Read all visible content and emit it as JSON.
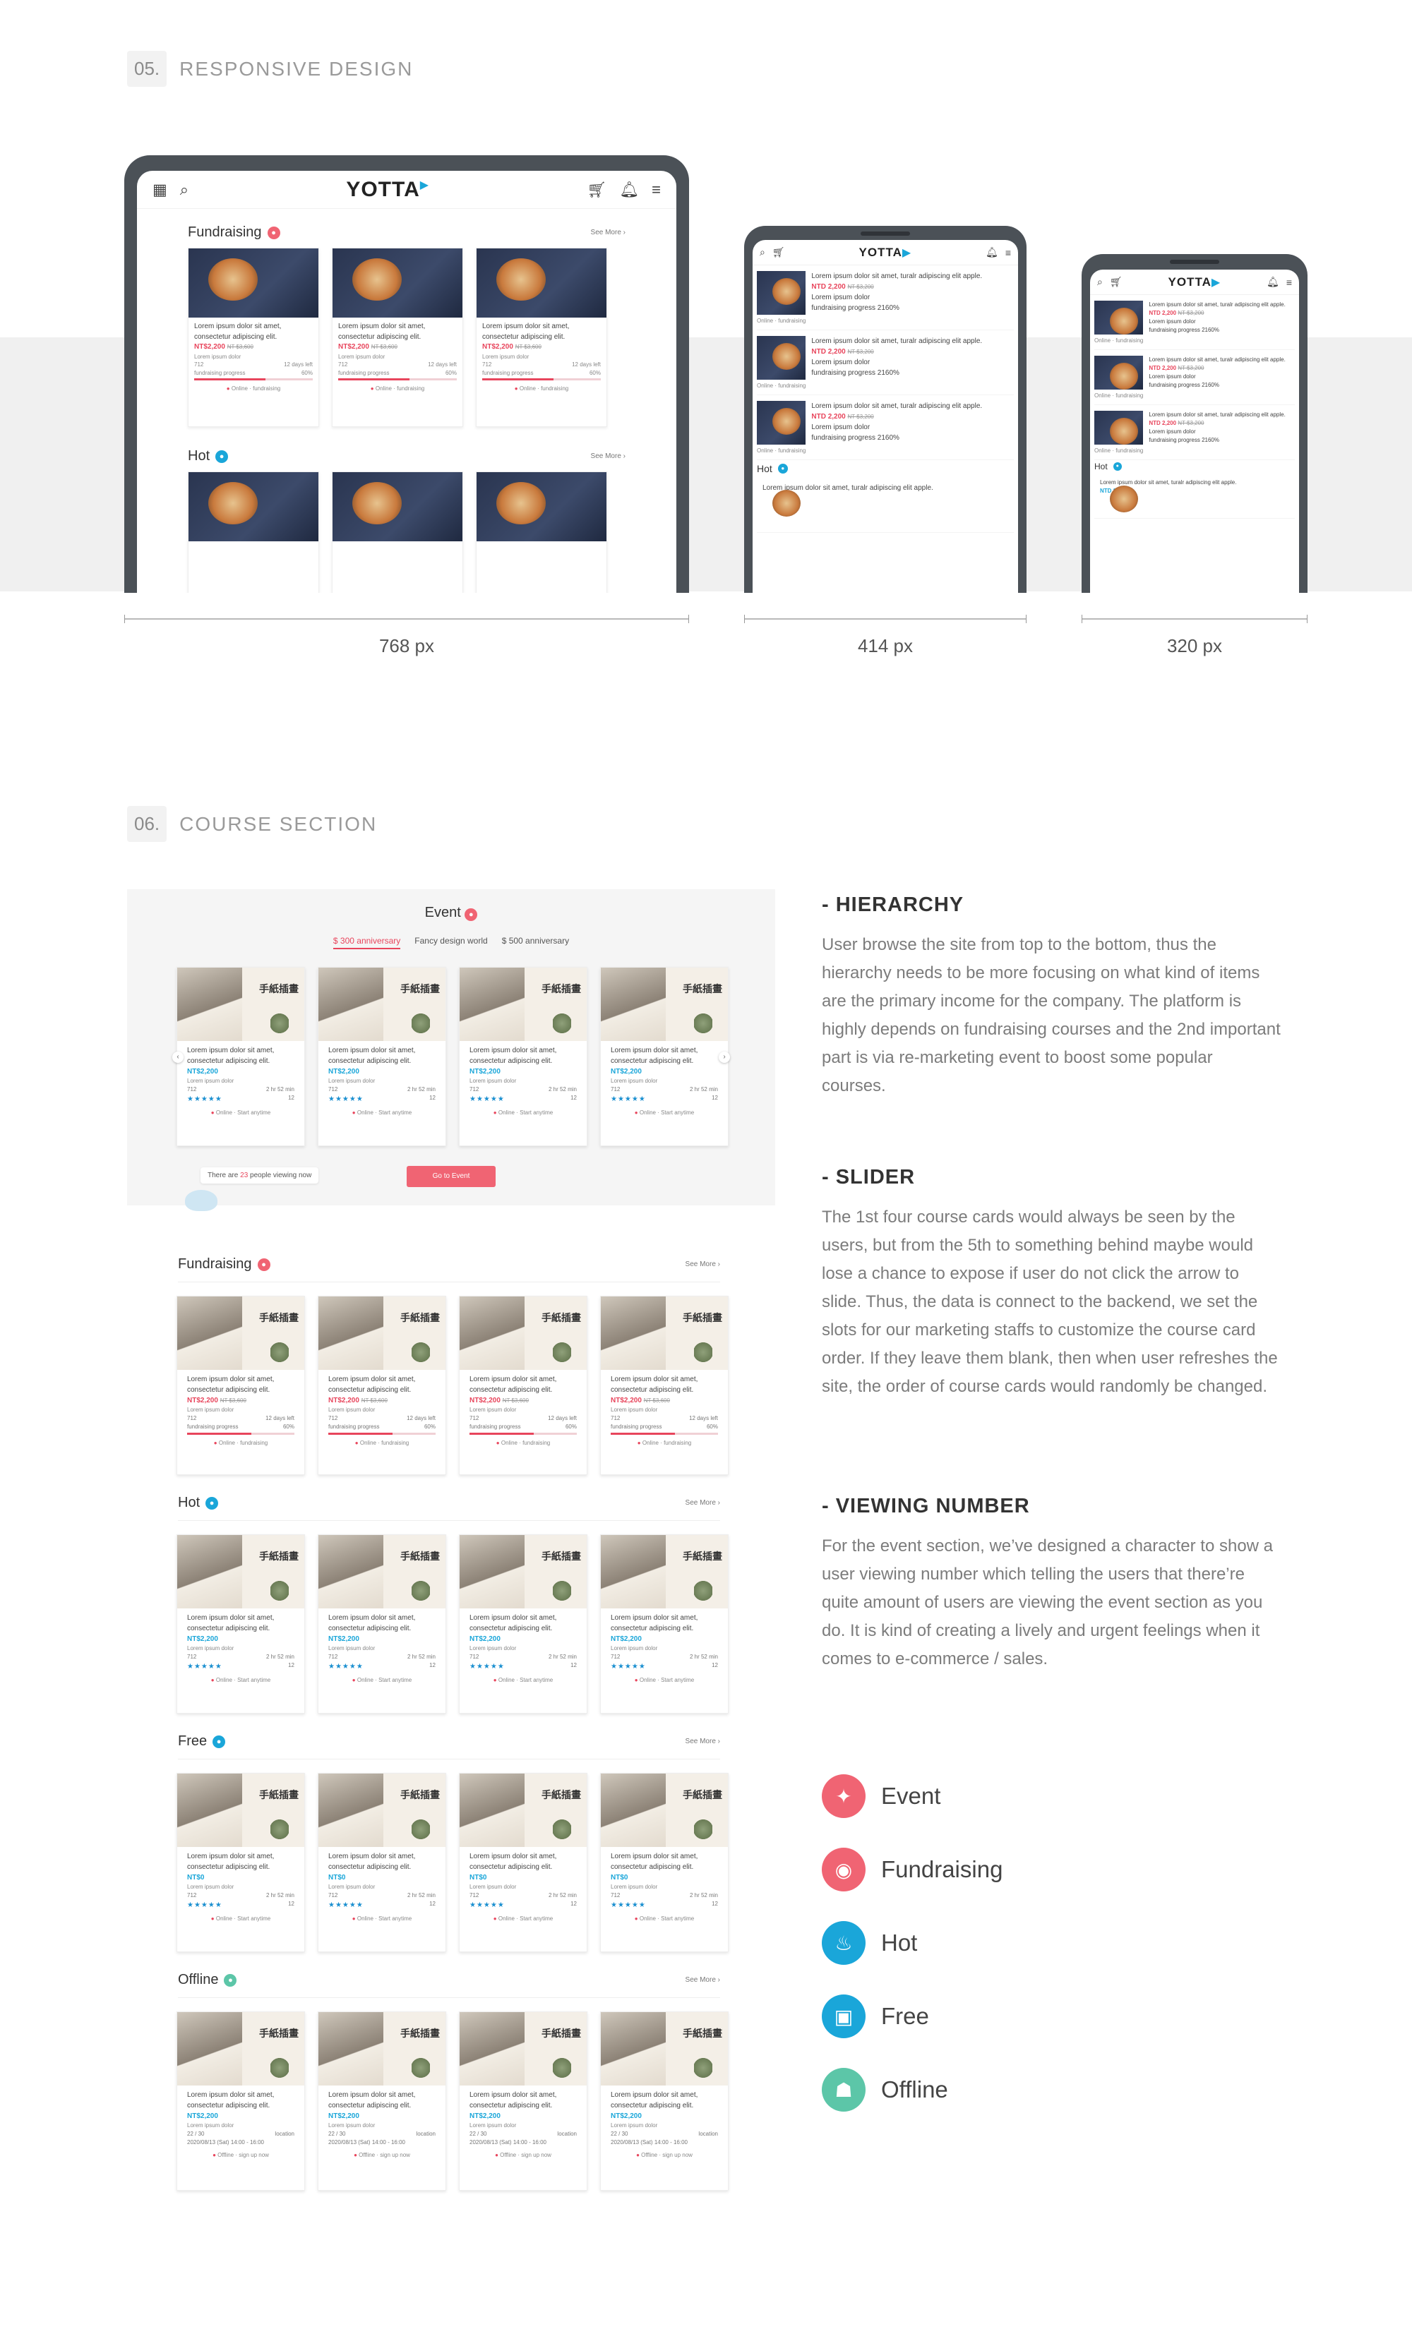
{
  "sections": {
    "responsive": {
      "num": "05.",
      "title": "RESPONSIVE DESIGN"
    },
    "course": {
      "num": "06.",
      "title": "COURSE SECTION"
    }
  },
  "devices": {
    "logo": "YOTTA",
    "labels": [
      "768 px",
      "414 px",
      "320 px"
    ]
  },
  "tablet": {
    "fundraising_label": "Fundraising",
    "hot_label": "Hot",
    "see_more": "See More ›",
    "card": {
      "title": "Lorem ipsum dolor sit amet, consectetur adipiscing elit.",
      "price": "NT$2,200",
      "old_price": "NT $3,600",
      "sub": "Lorem ipsum dolor",
      "count": "712",
      "days": "12 days left",
      "progress_label": "fundraising progress",
      "progress": "60%",
      "online": "Online · fundraising"
    }
  },
  "phone": {
    "title": "Lorem ipsum dolor sit amet, turalr adipiscing elit apple.",
    "price": "NTD 2,200",
    "old_price": "NT $3,200",
    "sub": "Lorem ipsum dolor",
    "progress": "fundraising progress 2160%",
    "online": "Online · fundraising",
    "hot_label": "Hot",
    "price_blue": "NTD 2,200"
  },
  "event": {
    "title": "Event",
    "tabs": [
      "$ 300 anniversary",
      "Fancy design world",
      "$ 500 anniversary"
    ],
    "viewing_prefix": "There are",
    "viewing_num": "23",
    "viewing_suffix": "people viewing now",
    "button": "Go to Event"
  },
  "course_card": {
    "title": "Lorem ipsum dolor sit amet, consectetur adipiscing elit.",
    "price": "NT$2,200",
    "old_price": "NT $3,600",
    "free_price": "NT$0",
    "sub": "Lorem ipsum dolor",
    "count": "712",
    "duration": "2 hr 52 min",
    "stars": "★★★★★",
    "rating_count": "12",
    "days": "12 days left",
    "progress_label": "fundraising progress",
    "progress": "60%",
    "online_start": "Online · Start anytime",
    "online_fund": "Online · fundraising",
    "offline_seats": "22 / 30",
    "offline_location": "location",
    "offline_date": "2020/08/13 (Sat) 14:00 - 16:00",
    "offline_signup": "Offline · sign up now"
  },
  "categories": [
    "Fundraising",
    "Hot",
    "Free",
    "Offline"
  ],
  "see_more": "See More ›",
  "text": {
    "hierarchy_title": "- HIERARCHY",
    "hierarchy_body": "User browse the site from top to the bottom, thus the hierarchy needs to be more focusing on what kind of items are the primary income for the company. The platform is highly depends on fundraising courses and the 2nd important part is via re-marketing event to boost some popular courses.",
    "slider_title": "- SLIDER",
    "slider_body": "The 1st four course cards would always be seen by the users, but from the 5th to something behind maybe would lose a chance to expose if user do not click the arrow to slide. Thus, the data is connect to the backend, we set the slots for our marketing staffs to customize the course card order. If they leave them blank, then when user refreshes the site, the order of course cards would randomly be changed.",
    "viewing_title": "- VIEWING NUMBER",
    "viewing_body": "For the event section, we’ve designed a character to show a user viewing number which telling the users that there’re quite amount of users are viewing the event section as you do. It is kind of creating a lively and urgent feelings when it comes to e-commerce / sales."
  },
  "legend": [
    {
      "label": "Event",
      "icon": "event-icon",
      "color": "#f06473"
    },
    {
      "label": "Fundraising",
      "icon": "piggy-bank-icon",
      "color": "#f06473"
    },
    {
      "label": "Hot",
      "icon": "flame-icon",
      "color": "#1aa6d9"
    },
    {
      "label": "Free",
      "icon": "gift-icon",
      "color": "#1aa6d9"
    },
    {
      "label": "Offline",
      "icon": "teacher-icon",
      "color": "#5cc6a8"
    }
  ],
  "colors": {
    "accent_red": "#e8455c",
    "accent_blue": "#1aa6d9",
    "accent_green": "#5cc6a8",
    "band_gray": "#f0f0f0"
  }
}
